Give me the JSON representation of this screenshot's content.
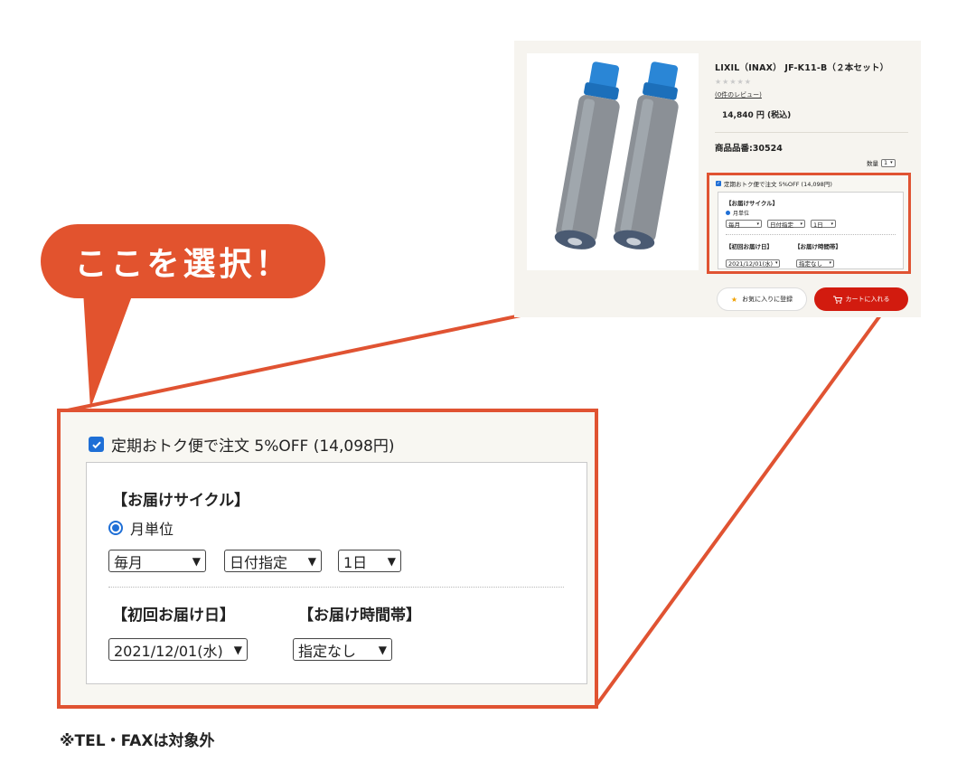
{
  "colors": {
    "accent": "#e05332",
    "checkbox": "#1f6fd6",
    "cart_button": "#d21b0f",
    "panel_bg": "#f6f4ef"
  },
  "callout": {
    "text": "ここを選択！"
  },
  "product": {
    "title": "LIXIL（INAX） JF-K11-B（２本セット）",
    "stars": "★★★★★",
    "review_link": "(0件のレビュー)",
    "price": "14,840 円 (税込)",
    "product_code": "商品品番:30524",
    "quantity_label": "数量",
    "quantity_value": "1",
    "favorite_button": "お気に入りに登録",
    "cart_button": "カートに入れる"
  },
  "subscription": {
    "checkbox_label": "定期おトク便で注文 5%OFF (14,098円)",
    "mini_checkbox_label": "定期おトク便で注文 5%OFF (14,098円)",
    "cycle_heading": "【お届けサイクル】",
    "radio_label": "月単位",
    "frequency_select": "毎月",
    "date_mode_select": "日付指定",
    "day_select": "1日",
    "first_delivery_heading": "【初回お届け日】",
    "first_delivery_select": "2021/12/01(水)",
    "time_heading": "【お届け時間帯】",
    "time_select": "指定なし"
  },
  "footnote": "※TEL・FAXは対象外"
}
